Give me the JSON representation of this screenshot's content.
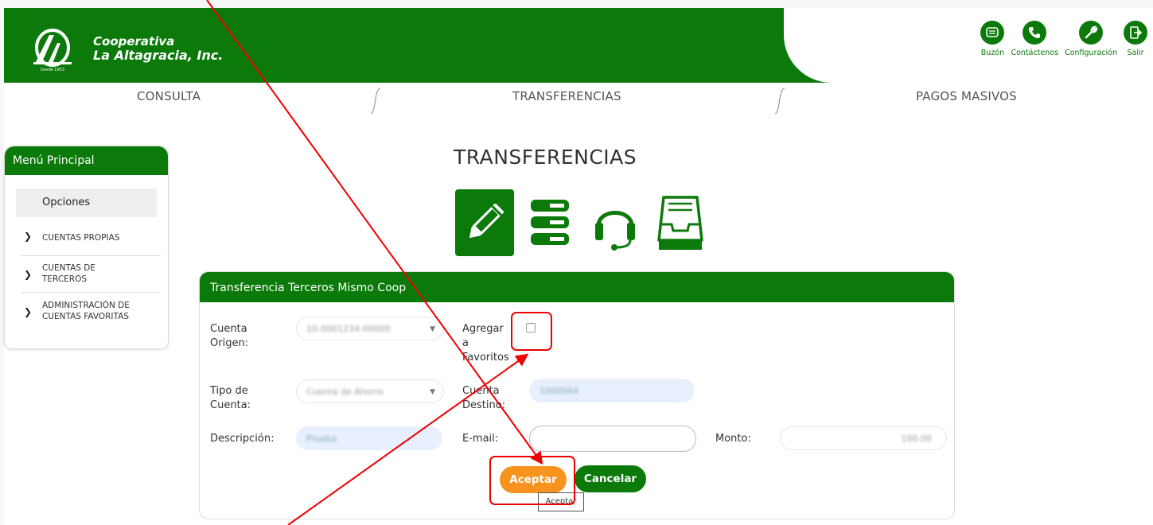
{
  "header": {
    "brand_line1": "Cooperativa",
    "brand_line2": "La Altagracia, Inc.",
    "brand_tag": "Desde 1953",
    "top_icons": [
      {
        "label": "Buzón",
        "icon": "mailbox-icon"
      },
      {
        "label": "Contáctenos",
        "icon": "phone-icon"
      },
      {
        "label": "Configuración",
        "icon": "wrench-icon"
      },
      {
        "label": "Salir",
        "icon": "exit-icon"
      }
    ]
  },
  "nav": {
    "items": [
      "CONSULTA",
      "TRANSFERENCIAS",
      "PAGOS MASIVOS"
    ]
  },
  "sidebar": {
    "title": "Menú Principal",
    "options_label": "Opciones",
    "items": [
      {
        "label": "CUENTAS PROPIAS"
      },
      {
        "label_line1": "CUENTAS DE",
        "label_line2": "TERCEROS"
      },
      {
        "label_line1": "ADMINISTRACIÓN DE",
        "label_line2": "CUENTAS FAVORITAS"
      }
    ]
  },
  "main": {
    "title": "TRANSFERENCIAS",
    "icons": [
      "edit-pencil-icon",
      "server-list-icon",
      "headset-icon",
      "inbox-tray-icon"
    ]
  },
  "form": {
    "title": "Transferencia Terceros Mismo Coop",
    "cuenta_origen_label_1": "Cuenta",
    "cuenta_origen_label_2": "Origen:",
    "cuenta_origen_value": "10-0001234-00000",
    "agregar_label_1": "Agregar",
    "agregar_label_2": "a",
    "agregar_label_3": "Favoritos",
    "tipo_cuenta_label_1": "Tipo de",
    "tipo_cuenta_label_2": "Cuenta:",
    "tipo_cuenta_value": "Cuenta de Ahorro",
    "cuenta_destino_label_1": "Cuenta",
    "cuenta_destino_label_2": "Destino:",
    "cuenta_destino_value": "1000564",
    "descripcion_label": "Descripción:",
    "descripcion_value": "Prueba",
    "email_label": "E-mail:",
    "email_value": "",
    "monto_label": "Monto:",
    "monto_value": "100.00",
    "accept_label": "Aceptar",
    "cancel_label": "Cancelar",
    "tooltip": "Aceptar"
  },
  "colors": {
    "brand_green": "#0b7a0b",
    "accept_orange": "#f7931e",
    "annotation_red": "#e00000"
  }
}
